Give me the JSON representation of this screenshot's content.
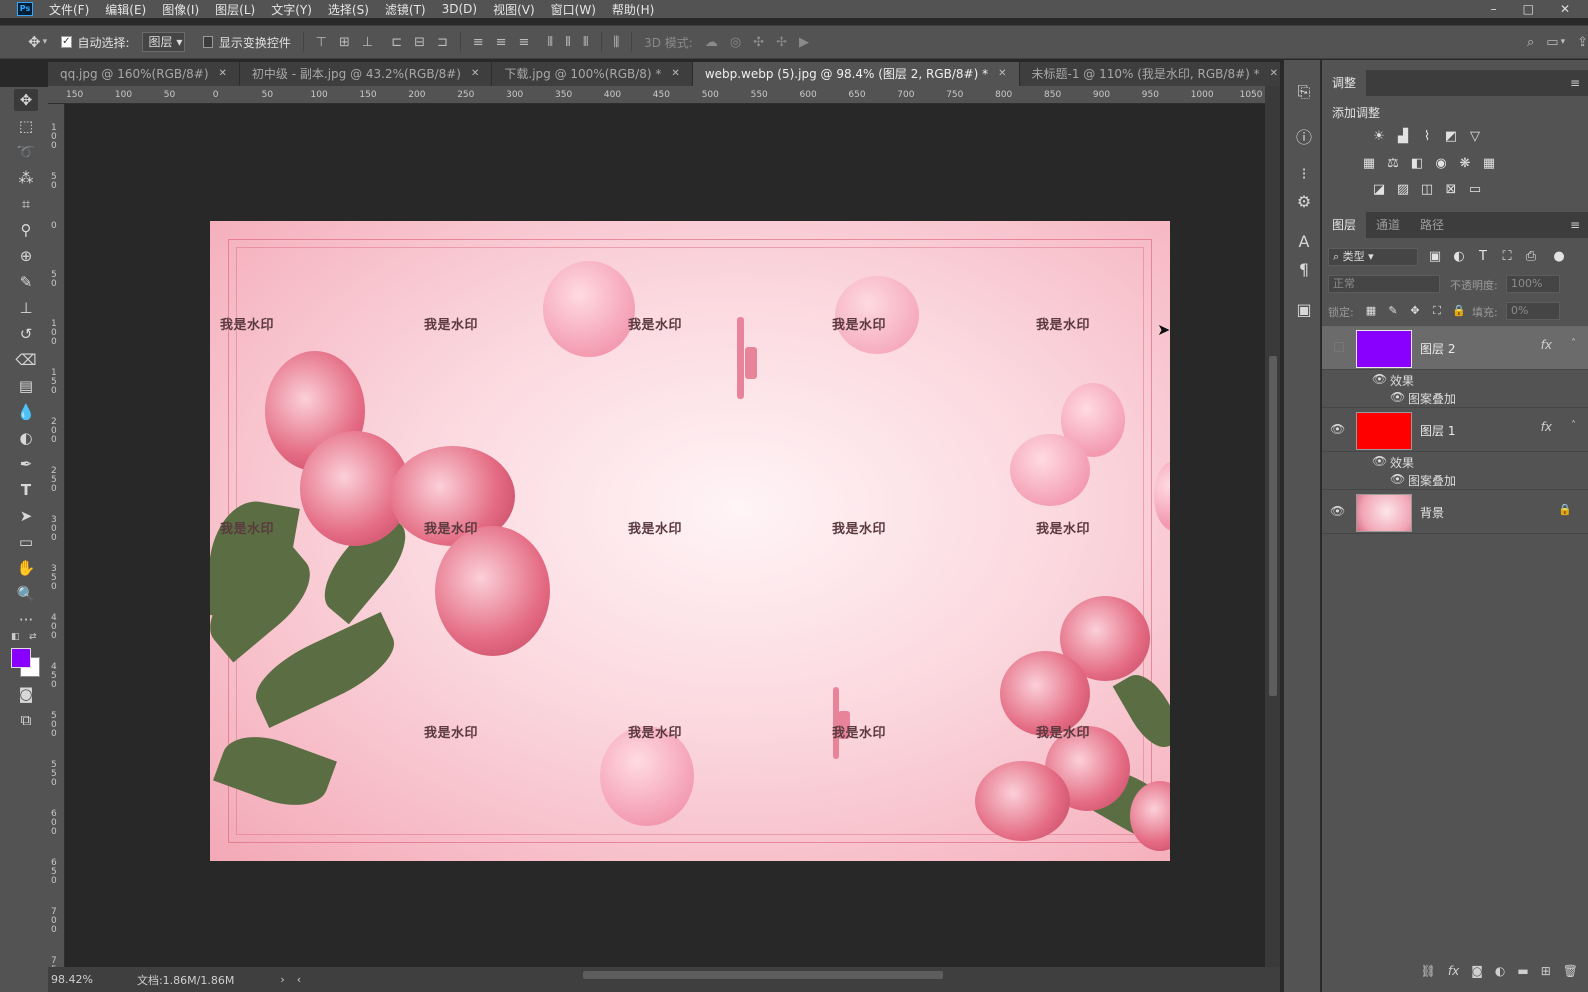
{
  "menubar": {
    "app_logo": "Ps",
    "items": [
      "文件(F)",
      "编辑(E)",
      "图像(I)",
      "图层(L)",
      "文字(Y)",
      "选择(S)",
      "滤镜(T)",
      "3D(D)",
      "视图(V)",
      "窗口(W)",
      "帮助(H)"
    ],
    "window_controls": [
      "–",
      "□",
      "✕"
    ]
  },
  "options_bar": {
    "auto_select_label": "自动选择:",
    "auto_select_checked": true,
    "auto_select_target": "图层",
    "show_transform_label": "显示变换控件",
    "show_transform_checked": false,
    "mode_label": "3D 模式:"
  },
  "tabs": [
    {
      "label": "qq.jpg @ 160%(RGB/8#)",
      "active": false
    },
    {
      "label": "初中级 - 副本.jpg @ 43.2%(RGB/8#)",
      "active": false
    },
    {
      "label": "下载.jpg @ 100%(RGB/8) *",
      "active": false
    },
    {
      "label": "webp.webp (5).jpg @ 98.4% (图层 2, RGB/8#) *",
      "active": true
    },
    {
      "label": "未标题-1 @ 110% (我是水印, RGB/8#) *",
      "active": false
    }
  ],
  "ruler": {
    "top_labels": [
      "150",
      "100",
      "50",
      "0",
      "50",
      "100",
      "150",
      "200",
      "250",
      "300",
      "350",
      "400",
      "450",
      "500",
      "550",
      "600",
      "650",
      "700",
      "750",
      "800",
      "850",
      "900",
      "950",
      "1000",
      "1050"
    ],
    "left_labels": [
      "1\n0\n0",
      "5\n0",
      "0",
      "5\n0",
      "1\n0\n0",
      "1\n5\n0",
      "2\n0\n0",
      "2\n5\n0",
      "3\n0\n0",
      "3\n5\n0",
      "4\n0\n0",
      "4\n5\n0",
      "5\n0\n0",
      "5\n5\n0",
      "6\n0\n0",
      "6\n5\n0",
      "7\n0\n0",
      "7\n5\n0"
    ]
  },
  "artwork": {
    "watermark_text": "我是水印",
    "watermark_count": 14
  },
  "statusbar": {
    "zoom": "98.42%",
    "doc_info": "文档:1.86M/1.86M"
  },
  "colors": {
    "foreground": "#8a00ff",
    "background": "#ffffff",
    "layer2_fill": "#8a00ff",
    "layer1_fill": "#ff0000"
  },
  "adjustments_panel": {
    "tab_label": "调整",
    "add_label": "添加调整"
  },
  "layers_panel": {
    "tabs": [
      "图层",
      "通道",
      "路径"
    ],
    "filter_kind": "类型",
    "blend_mode": "正常",
    "opacity_label": "不透明度:",
    "opacity_value": "100%",
    "lock_label": "锁定:",
    "fill_label": "填充:",
    "fill_value": "0%",
    "layers": [
      {
        "name": "图层 2",
        "visible": false,
        "selected": true,
        "fx": "fx",
        "effects_label": "效果",
        "effect": "图案叠加"
      },
      {
        "name": "图层 1",
        "visible": true,
        "selected": false,
        "fx": "fx",
        "effects_label": "效果",
        "effect": "图案叠加"
      },
      {
        "name": "背景",
        "visible": true,
        "selected": false,
        "locked": true
      }
    ]
  }
}
